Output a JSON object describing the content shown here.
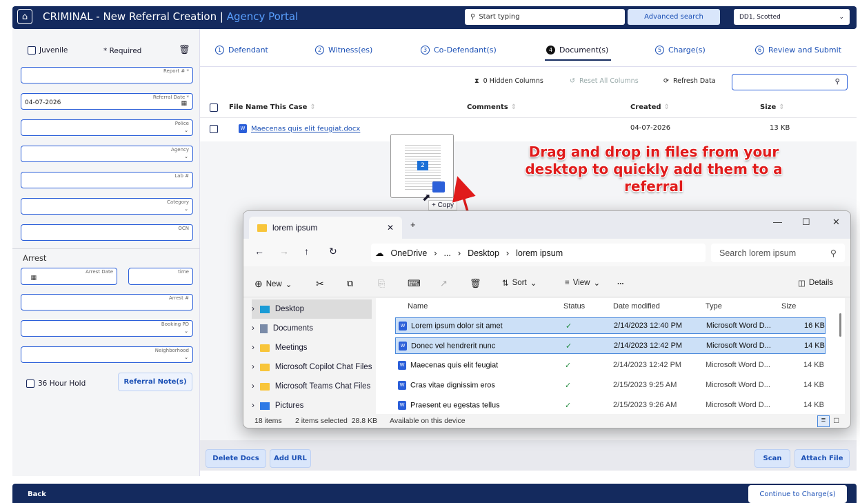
{
  "header": {
    "app_title": "CRIMINAL - New Referral Creation",
    "separator": " | ",
    "portal": "Agency Portal",
    "search_placeholder": "Start typing",
    "advanced_search": "Advanced search",
    "user": "DD1, Scotted"
  },
  "left": {
    "juvenile": "Juvenile",
    "required": "* Required",
    "fields": [
      {
        "label": "Report # *",
        "value": ""
      },
      {
        "label": "Referral Date *",
        "value": "04-07-2026"
      },
      {
        "label": "Police",
        "value": ""
      },
      {
        "label": "Agency",
        "value": ""
      },
      {
        "label": "Lab #",
        "value": ""
      },
      {
        "label": "Category",
        "value": ""
      },
      {
        "label": "OCN",
        "value": ""
      }
    ],
    "arrest_heading": "Arrest",
    "arrest_date_label": "Arrest Date",
    "time_label": "time",
    "arrest_num_label": "Arrest #",
    "booking_pd_label": "Booking PD",
    "neighborhood_label": "Neighborhood",
    "hold_label": "36 Hour Hold",
    "referral_notes": "Referral Note(s)"
  },
  "tabs": [
    {
      "num": "1",
      "label": "Defendant"
    },
    {
      "num": "2",
      "label": "Witness(es)"
    },
    {
      "num": "3",
      "label": "Co-Defendant(s)"
    },
    {
      "num": "4",
      "label": "Document(s)"
    },
    {
      "num": "5",
      "label": "Charge(s)"
    },
    {
      "num": "6",
      "label": "Review and Submit"
    }
  ],
  "toolbar": {
    "hidden_columns": "0 Hidden Columns",
    "reset_columns": "Reset All Columns",
    "refresh": "Refresh Data"
  },
  "table": {
    "columns": [
      "File Name This Case",
      "Comments",
      "Created",
      "Size"
    ],
    "rows": [
      {
        "file": "Maecenas quis elit feugiat.docx",
        "comments": "",
        "created": "04-07-2026",
        "size": "13 KB"
      }
    ]
  },
  "drag": {
    "badge": "2",
    "copy_label": "+ Copy"
  },
  "annotation": "Drag and drop in files from your desktop to quickly add them to a referral",
  "explorer": {
    "tab_title": "lorem ipsum",
    "breadcrumb": [
      "OneDrive",
      "...",
      "Desktop",
      "lorem ipsum"
    ],
    "search_placeholder": "Search lorem ipsum",
    "commands": {
      "new": "New",
      "sort": "Sort",
      "view": "View",
      "more": "...",
      "details": "Details"
    },
    "nav_items": [
      "Desktop",
      "Documents",
      "Meetings",
      "Microsoft Copilot Chat Files",
      "Microsoft Teams Chat Files",
      "Pictures"
    ],
    "columns": [
      "Name",
      "Status",
      "Date modified",
      "Type",
      "Size"
    ],
    "files": [
      {
        "name": "Lorem ipsum dolor sit amet",
        "date": "2/14/2023 12:40 PM",
        "type": "Microsoft Word D...",
        "size": "16 KB"
      },
      {
        "name": "Donec vel hendrerit nunc",
        "date": "2/14/2023 12:42 PM",
        "type": "Microsoft Word D...",
        "size": "14 KB"
      },
      {
        "name": "Maecenas quis elit feugiat",
        "date": "2/14/2023 12:42 PM",
        "type": "Microsoft Word D...",
        "size": "14 KB"
      },
      {
        "name": "Cras vitae dignissim eros",
        "date": "2/15/2023 9:25 AM",
        "type": "Microsoft Word D...",
        "size": "14 KB"
      },
      {
        "name": "Praesent eu egestas tellus",
        "date": "2/15/2023 9:26 AM",
        "type": "Microsoft Word D...",
        "size": "14 KB"
      }
    ],
    "status_items": "18 items",
    "status_selected": "2 items selected  28.8 KB",
    "status_avail": "Available on this device"
  },
  "bottom": {
    "delete_docs": "Delete Docs",
    "add_url": "Add URL",
    "scan": "Scan",
    "attach_file": "Attach File"
  },
  "footer": {
    "back": "Back",
    "continue": "Continue to Charge(s)"
  },
  "colors": {
    "navy": "#142a5e",
    "accent": "#2b5fd9",
    "annotation": "#e01b1b"
  }
}
